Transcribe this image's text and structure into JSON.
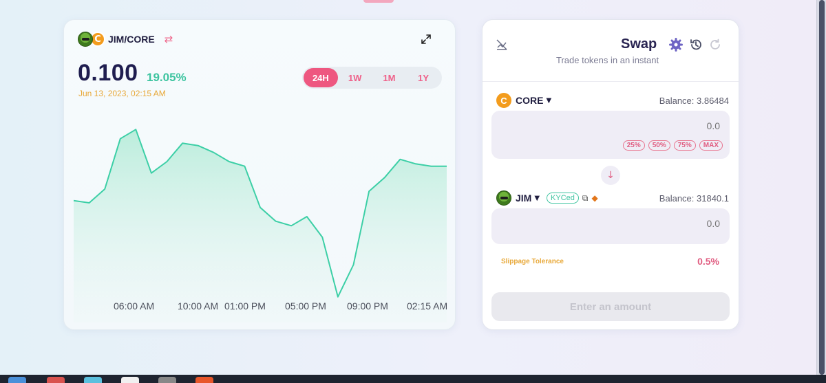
{
  "chart_panel": {
    "pair_label": "JIM/CORE",
    "core_letter": "C",
    "price": "0.100",
    "change": "19.05%",
    "date": "Jun 13, 2023, 02:15 AM",
    "ranges": [
      "24H",
      "1W",
      "1M",
      "1Y"
    ],
    "active_range": "24H",
    "icons": {
      "jim_token": "frog-token-icon",
      "core_token": "core-token-icon",
      "swap_pair": "swap-arrows-icon",
      "expand": "expand-icon"
    }
  },
  "chart_data": {
    "type": "area",
    "x_tick_labels": [
      "06:00 AM",
      "10:00 AM",
      "01:00 PM",
      "05:00 PM",
      "09:00 PM",
      "02:15 AM"
    ],
    "values": [
      0.058,
      0.057,
      0.063,
      0.085,
      0.089,
      0.07,
      0.075,
      0.083,
      0.082,
      0.079,
      0.075,
      0.073,
      0.055,
      0.049,
      0.047,
      0.051,
      0.042,
      0.016,
      0.03,
      0.062,
      0.068,
      0.076,
      0.074,
      0.073,
      0.073
    ],
    "line_color": "#3ccfa6",
    "fill_color": "#bff0df",
    "grid": false,
    "legend": "none"
  },
  "swap_panel": {
    "title": "Swap",
    "subtitle": "Trade tokens in an instant",
    "icons": {
      "chart_toggle": "chart-off-icon",
      "settings": "gear-icon",
      "history": "history-icon",
      "refresh": "refresh-icon",
      "flip": "arrow-down-icon",
      "copy": "copy-icon",
      "metamask": "metamask-fox-icon"
    },
    "from": {
      "token": "CORE",
      "balance": "Balance: 3.86484",
      "amount": "0.0",
      "percent_buttons": [
        "25%",
        "50%",
        "75%",
        "MAX"
      ]
    },
    "to": {
      "token": "JIM",
      "badge": "KYCed",
      "balance": "Balance: 31840.1",
      "amount": "0.0"
    },
    "slippage_label": "Slippage Tolerance",
    "slippage_value": "0.5%",
    "submit_label": "Enter an amount"
  },
  "colors": {
    "accent_pink": "#ee5780",
    "accent_green": "#3ec4a0",
    "title_navy": "#1f1d4f",
    "date_orange": "#e8a838"
  }
}
